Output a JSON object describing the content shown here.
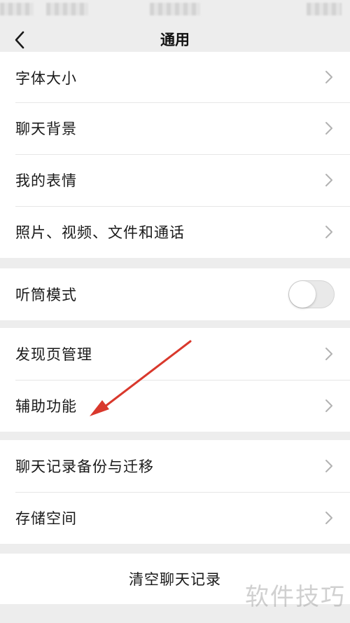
{
  "nav": {
    "title": "通用",
    "back_icon": "back-chevron-icon"
  },
  "groups": [
    {
      "items": [
        {
          "label": "字体大小",
          "accessory": "chevron"
        },
        {
          "label": "聊天背景",
          "accessory": "chevron"
        },
        {
          "label": "我的表情",
          "accessory": "chevron"
        },
        {
          "label": "照片、视频、文件和通话",
          "accessory": "chevron"
        }
      ]
    },
    {
      "items": [
        {
          "label": "听筒模式",
          "accessory": "toggle",
          "toggle_on": false
        }
      ]
    },
    {
      "items": [
        {
          "label": "发现页管理",
          "accessory": "chevron"
        },
        {
          "label": "辅助功能",
          "accessory": "chevron"
        }
      ]
    },
    {
      "items": [
        {
          "label": "聊天记录备份与迁移",
          "accessory": "chevron"
        },
        {
          "label": "存储空间",
          "accessory": "chevron"
        }
      ]
    }
  ],
  "clear_chat": {
    "label": "清空聊天记录"
  },
  "watermark": {
    "text": "软件技巧"
  },
  "annotation": {
    "type": "red-arrow",
    "color": "#d9382c",
    "points_to": "辅助功能"
  },
  "colors": {
    "background": "#ededed",
    "card": "#ffffff",
    "separator": "#e6e6e6",
    "chevron": "#b2b2b2",
    "toggle_off": "#e9e9e9"
  }
}
